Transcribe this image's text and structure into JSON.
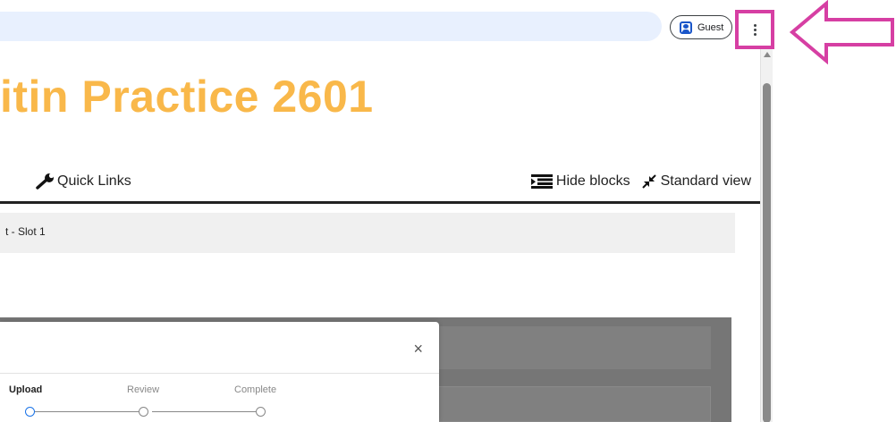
{
  "browser": {
    "profile_label": "Guest",
    "menu_icon": "kebab-menu-icon"
  },
  "page": {
    "course_title": "itin Practice 2601",
    "nav": {
      "quick_links_label": "Quick Links",
      "hide_blocks_label": "Hide blocks",
      "standard_view_label": "Standard view"
    },
    "breadcrumb": "t - Slot 1"
  },
  "modal": {
    "close_label": "×",
    "steps": [
      {
        "label": "Upload",
        "active": true
      },
      {
        "label": "Review",
        "active": false
      },
      {
        "label": "Complete",
        "active": false
      }
    ]
  },
  "colors": {
    "title": "#f9b84a",
    "annotation": "#d63fa3",
    "address_bar": "#e8f0fe"
  }
}
